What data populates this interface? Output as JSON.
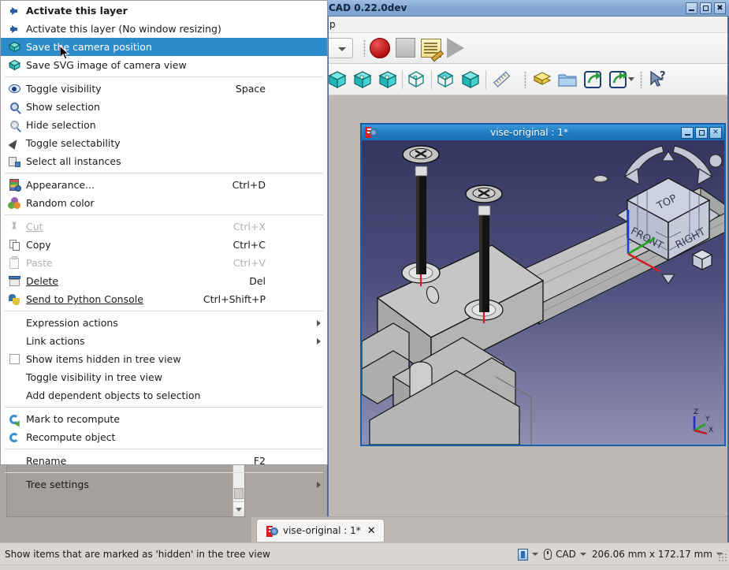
{
  "window": {
    "title": "CAD 0.22.0dev",
    "buttons": {
      "minimize": "minimize-button",
      "maximize": "maximize-button",
      "close": "close-button"
    },
    "menubar_fragment": "p"
  },
  "toolbars": {
    "row1": [
      {
        "name": "workbench-selector",
        "label": ""
      },
      {
        "name": "macro-record",
        "label": "Macro recording..."
      },
      {
        "name": "macro-stop",
        "label": "Stop macro recording"
      },
      {
        "name": "macro-edit",
        "label": "Macros..."
      },
      {
        "name": "macro-execute",
        "label": "Execute macro"
      }
    ],
    "row2": [
      {
        "name": "create-part",
        "label": "Create part"
      },
      {
        "name": "create-group",
        "label": "Create group"
      },
      {
        "name": "create-part-simple",
        "label": "Create a part"
      },
      {
        "name": "box-wireframe-1",
        "label": "Box element"
      },
      {
        "name": "box-wireframe-2",
        "label": "Box element"
      },
      {
        "name": "box-solid",
        "label": "Box element"
      },
      {
        "name": "measure-ruler",
        "label": "Measure"
      },
      {
        "name": "workbench-stack",
        "label": "Workbench"
      },
      {
        "name": "open-folder",
        "label": "Open"
      },
      {
        "name": "make-link",
        "label": "Make link"
      },
      {
        "name": "make-link-group",
        "label": "Make link group"
      },
      {
        "name": "whats-this",
        "label": "What's This?"
      }
    ]
  },
  "context_menu": {
    "items": [
      {
        "id": "activate-this-layer",
        "label": "Activate this layer",
        "shortcut": "",
        "icon": "arrow-right-icon",
        "bold": true,
        "state": "normal"
      },
      {
        "id": "activate-this-layer-no-resize",
        "label": "Activate this layer (No window resizing)",
        "shortcut": "",
        "icon": "arrow-right-icon",
        "bold": false,
        "state": "normal"
      },
      {
        "id": "save-the-camera-position",
        "label": "Save the camera position",
        "shortcut": "",
        "icon": "camera-cube-icon",
        "bold": false,
        "state": "highlighted"
      },
      {
        "id": "save-svg-image-of-camera-view",
        "label": "Save SVG image of camera view",
        "shortcut": "",
        "icon": "camera-cube-icon",
        "bold": false,
        "state": "normal"
      },
      {
        "id": "separator-1",
        "type": "separator"
      },
      {
        "id": "toggle-visibility",
        "label": "Toggle visibility",
        "shortcut": "Space",
        "icon": "eye-icon",
        "bold": false,
        "state": "normal"
      },
      {
        "id": "show-selection",
        "label": "Show selection",
        "shortcut": "",
        "icon": "show-selection-icon",
        "bold": false,
        "state": "normal"
      },
      {
        "id": "hide-selection",
        "label": "Hide selection",
        "shortcut": "",
        "icon": "hide-selection-icon",
        "bold": false,
        "state": "normal"
      },
      {
        "id": "toggle-selectability",
        "label": "Toggle selectability",
        "shortcut": "",
        "icon": "cursor-arrow-icon",
        "bold": false,
        "state": "normal"
      },
      {
        "id": "select-all-instances",
        "label": "Select all instances",
        "shortcut": "",
        "icon": "select-all-icon",
        "bold": false,
        "state": "normal"
      },
      {
        "id": "separator-2",
        "type": "separator"
      },
      {
        "id": "appearance",
        "label": "Appearance...",
        "shortcut": "Ctrl+D",
        "icon": "appearance-icon",
        "bold": false,
        "state": "normal"
      },
      {
        "id": "random-color",
        "label": "Random color",
        "shortcut": "",
        "icon": "random-color-icon",
        "bold": false,
        "state": "normal"
      },
      {
        "id": "separator-3",
        "type": "separator"
      },
      {
        "id": "cut",
        "label": "Cut",
        "shortcut": "Ctrl+X",
        "icon": "scissors-icon",
        "bold": false,
        "state": "disabled"
      },
      {
        "id": "copy",
        "label": "Copy",
        "shortcut": "Ctrl+C",
        "icon": "copy-icon",
        "bold": false,
        "state": "normal"
      },
      {
        "id": "paste",
        "label": "Paste",
        "shortcut": "Ctrl+V",
        "icon": "paste-icon",
        "bold": false,
        "state": "disabled"
      },
      {
        "id": "delete",
        "label": "Delete",
        "shortcut": "Del",
        "icon": "delete-icon",
        "bold": false,
        "state": "normal"
      },
      {
        "id": "send-to-python-console",
        "label": "Send to Python Console",
        "shortcut": "Ctrl+Shift+P",
        "icon": "python-icon",
        "bold": false,
        "state": "normal"
      },
      {
        "id": "separator-4",
        "type": "separator"
      },
      {
        "id": "expression-actions",
        "label": "Expression actions",
        "shortcut": "",
        "icon": "",
        "bold": false,
        "state": "normal",
        "submenu": true
      },
      {
        "id": "link-actions",
        "label": "Link actions",
        "shortcut": "",
        "icon": "",
        "bold": false,
        "state": "normal",
        "submenu": true
      },
      {
        "id": "show-items-hidden-in-tree-view",
        "label": "Show items hidden in tree view",
        "shortcut": "",
        "icon": "checkbox-icon",
        "bold": false,
        "state": "normal",
        "checkbox": true,
        "checked": false
      },
      {
        "id": "toggle-visibility-in-tree-view",
        "label": "Toggle visibility in tree view",
        "shortcut": "",
        "icon": "",
        "bold": false,
        "state": "normal"
      },
      {
        "id": "add-dependent-objects-to-selection",
        "label": "Add dependent objects to selection",
        "shortcut": "",
        "icon": "",
        "bold": false,
        "state": "normal"
      },
      {
        "id": "separator-5",
        "type": "separator"
      },
      {
        "id": "mark-to-recompute",
        "label": "Mark to recompute",
        "shortcut": "",
        "icon": "mark-recompute-icon",
        "bold": false,
        "state": "normal"
      },
      {
        "id": "recompute-object",
        "label": "Recompute object",
        "shortcut": "",
        "icon": "recompute-icon",
        "bold": false,
        "state": "normal"
      },
      {
        "id": "separator-6",
        "type": "separator"
      },
      {
        "id": "rename",
        "label": "Rename",
        "shortcut": "F2",
        "icon": "",
        "bold": false,
        "state": "normal"
      },
      {
        "id": "separator-7",
        "type": "separator"
      },
      {
        "id": "tree-settings",
        "label": "Tree settings",
        "shortcut": "",
        "icon": "",
        "bold": false,
        "state": "normal",
        "submenu": true
      }
    ]
  },
  "mdi_window": {
    "title": "vise-original : 1*",
    "buttons": {
      "minimize": "minimize-button",
      "maximize": "maximize-button",
      "close": "close-button"
    },
    "navigation_cube": {
      "faces": [
        "TOP",
        "FRONT",
        "RIGHT"
      ]
    },
    "axis_labels": {
      "x": "X",
      "y": "Y",
      "z": "Z"
    },
    "colors": {
      "title_bg": "#1e7cc4",
      "bg_top": "#34365f",
      "bg_bottom": "#8b8bb0",
      "model_grey": "#b5b5b5"
    }
  },
  "tabbar": {
    "tabs": [
      {
        "label": "vise-original : 1*",
        "close": "✕",
        "active": true
      }
    ]
  },
  "statusbar": {
    "message": "Show items that are marked as 'hidden' in the tree view",
    "navigation_style": "CAD",
    "dimensions": "206.06 mm x 172.17 mm"
  },
  "colors": {
    "menu_highlight": "#2c8cc9",
    "titlebar": "#82a7d4",
    "accent": "#1e7cc4",
    "workspace_bg": "#bdb9b4",
    "statusbar_bg": "#d9d5d0"
  }
}
